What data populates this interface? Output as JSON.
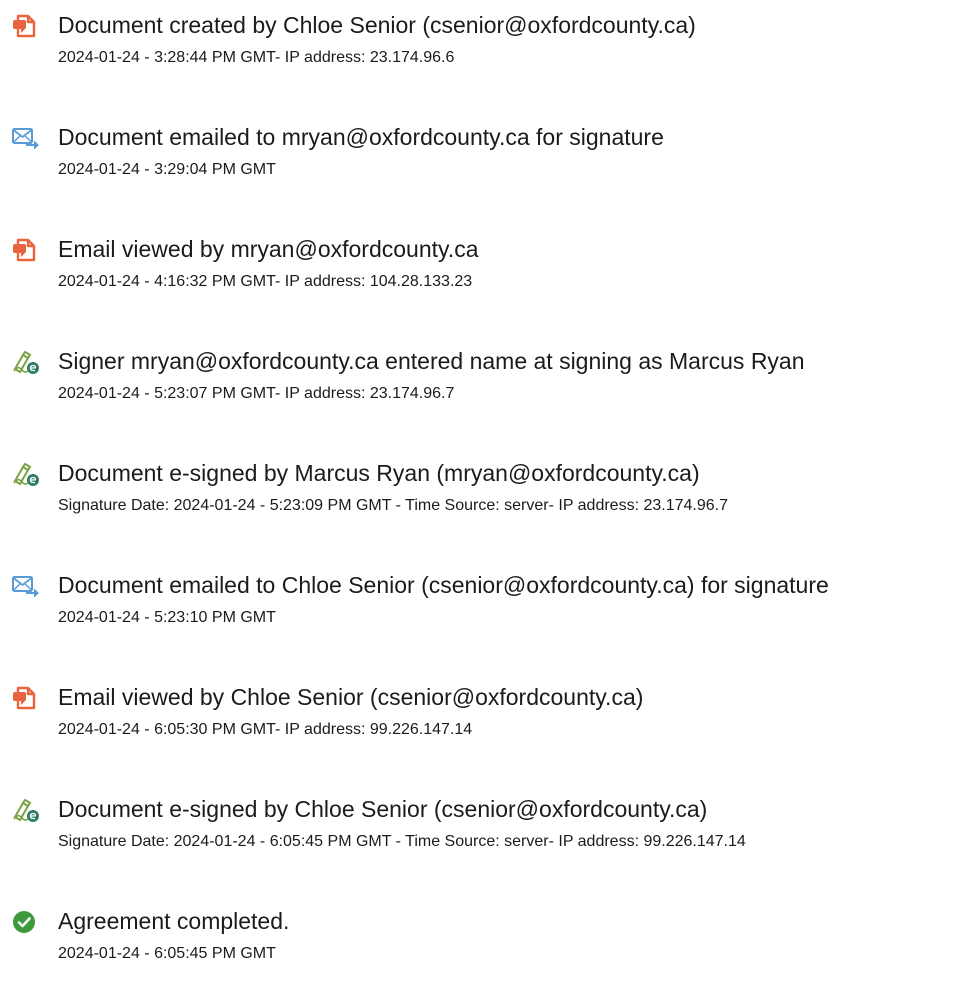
{
  "colors": {
    "doc_icon": "#e8643c",
    "email_icon": "#5b9bd5",
    "sign_icon_pen": "#7aa342",
    "sign_icon_badge": "#2e7d6a",
    "complete_icon": "#3c9a3c",
    "text": "#1b1b1b"
  },
  "events": [
    {
      "icon": "document-icon",
      "title": "Document created by Chloe Senior (csenior@oxfordcounty.ca)",
      "detail": "2024-01-24 - 3:28:44 PM GMT- IP address: 23.174.96.6"
    },
    {
      "icon": "email-icon",
      "title": "Document emailed to mryan@oxfordcounty.ca for signature",
      "detail": "2024-01-24 - 3:29:04 PM GMT"
    },
    {
      "icon": "document-icon",
      "title": "Email viewed by mryan@oxfordcounty.ca",
      "detail": "2024-01-24 - 4:16:32 PM GMT- IP address: 104.28.133.23"
    },
    {
      "icon": "signature-pen-icon",
      "title": "Signer mryan@oxfordcounty.ca entered name at signing as Marcus Ryan",
      "detail": "2024-01-24 - 5:23:07 PM GMT- IP address: 23.174.96.7"
    },
    {
      "icon": "signature-pen-icon",
      "title": "Document e-signed by Marcus Ryan (mryan@oxfordcounty.ca)",
      "detail": "Signature Date: 2024-01-24 - 5:23:09 PM GMT - Time Source: server- IP address: 23.174.96.7"
    },
    {
      "icon": "email-icon",
      "title": "Document emailed to Chloe Senior (csenior@oxfordcounty.ca) for signature",
      "detail": "2024-01-24 - 5:23:10 PM GMT"
    },
    {
      "icon": "document-icon",
      "title": "Email viewed by Chloe Senior (csenior@oxfordcounty.ca)",
      "detail": "2024-01-24 - 6:05:30 PM GMT- IP address: 99.226.147.14"
    },
    {
      "icon": "signature-pen-icon",
      "title": "Document e-signed by Chloe Senior (csenior@oxfordcounty.ca)",
      "detail": "Signature Date: 2024-01-24 - 6:05:45 PM GMT - Time Source: server- IP address: 99.226.147.14"
    },
    {
      "icon": "completed-check-icon",
      "title": "Agreement completed.",
      "detail": "2024-01-24 - 6:05:45 PM GMT"
    }
  ]
}
